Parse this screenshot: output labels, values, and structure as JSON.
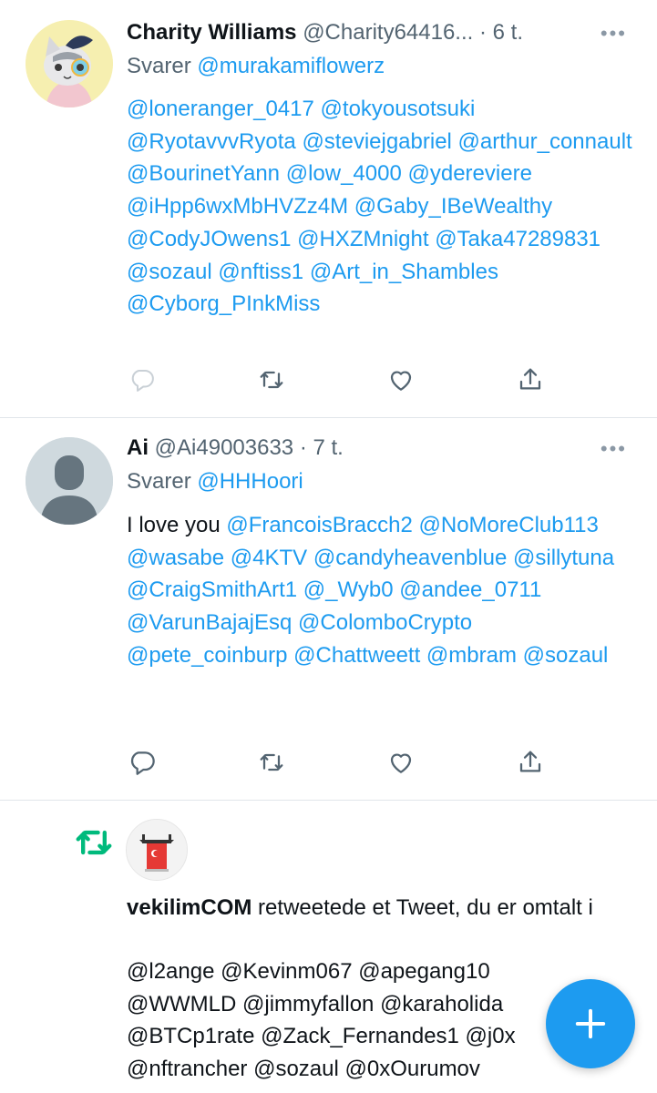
{
  "tweets": [
    {
      "name": "Charity Williams",
      "handle": "@Charity64416...",
      "sep": " · ",
      "time": "6 t.",
      "more": "•••",
      "reply_prefix": "Svarer ",
      "reply_handle": "@murakamiflowerz",
      "body_prefix": "",
      "mentions": [
        "@loneranger_0417",
        "@tokyousotsuki",
        "@RyotavvvRyota",
        "@steviejgabriel",
        "@arthur_connault",
        "@BourinetYann",
        "@low_4000",
        "@ydereviere",
        "@iHpp6wxMbHVZz4M",
        "@Gaby_IBeWealthy",
        "@CodyJOwens1",
        "@HXZMnight",
        "@Taka47289831",
        "@sozaul",
        "@nftiss1",
        "@Art_in_Shambles",
        "@Cyborg_PInkMiss"
      ]
    },
    {
      "name": "Ai",
      "handle": "@Ai49003633",
      "sep": " · ",
      "time": "7 t.",
      "more": "•••",
      "reply_prefix": "Svarer ",
      "reply_handle": "@HHHoori",
      "body_prefix": "I love you",
      "mentions": [
        "@FrancoisBracch2",
        "@NoMoreClub113",
        "@wasabe",
        "@4KTV",
        "@candyheavenblue",
        "@sillytuna",
        "@CraigSmithArt1",
        "@_Wyb0",
        "@andee_0711",
        "@VarunBajajEsq",
        "@ColomboCrypto",
        "@pete_coinburp",
        "@Chattweett",
        "@mbram",
        "@sozaul"
      ]
    }
  ],
  "retweet_notice": {
    "user": "vekilimCOM",
    "text": " retweetede et Tweet, du er omtalt i",
    "mention_lines": [
      "@l2ange @Kevinm067 @apegang10",
      "@WWMLD @jimmyfallon @karaholida",
      "@BTCp1rate @Zack_Fernandes1 @j0x",
      "@nftrancher @sozaul @0xOurumov"
    ]
  },
  "colors": {
    "accent": "#1d9bf0",
    "text": "#0f1419",
    "secondary": "#536471",
    "retweet_green": "#00ba7c"
  },
  "icons": [
    "reply-icon",
    "retweet-icon",
    "like-icon",
    "share-icon",
    "compose-plus-icon"
  ]
}
